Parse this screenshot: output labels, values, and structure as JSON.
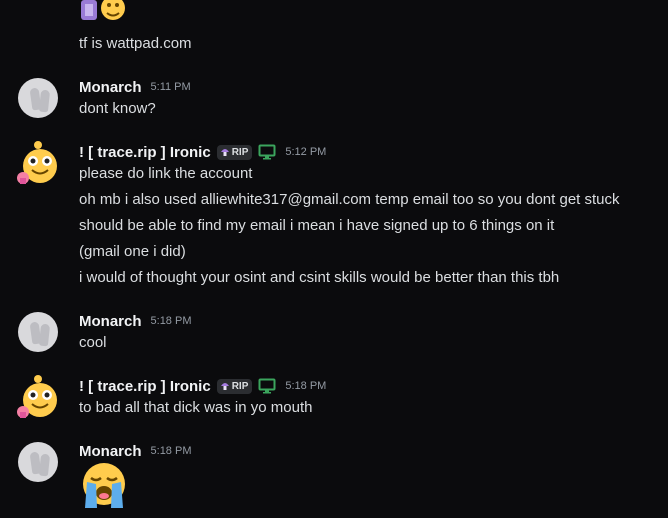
{
  "top_message": {
    "text": "tf is wattpad.com"
  },
  "messages": [
    {
      "author": "Monarch",
      "time": "5:11 PM",
      "lines": [
        "dont know?"
      ]
    },
    {
      "author": "! [ trace.rip ] Ironic",
      "badge": "RIP",
      "time": "5:12 PM",
      "lines": [
        "please do link the account",
        "oh mb i also used alliewhite317@gmail.com temp email too so you dont get stuck",
        "should be able to find my email i mean i have signed up to 6 things on it",
        "(gmail one i did)",
        "i would of thought your osint and csint skills would be better than this tbh"
      ]
    },
    {
      "author": "Monarch",
      "time": "5:18 PM",
      "lines": [
        "cool"
      ]
    },
    {
      "author": "! [ trace.rip ] Ironic",
      "badge": "RIP",
      "time": "5:18 PM",
      "lines": [
        "to bad all that dick was in yo mouth"
      ]
    },
    {
      "author": "Monarch",
      "time": "5:18 PM",
      "emoji": "loudly-crying-face"
    }
  ],
  "colors": {
    "background": "#0b0b0d",
    "username": "#f2f3f5",
    "timestamp": "#949ba4",
    "text": "#dbdee1",
    "device_icon": "#3ba55d"
  }
}
